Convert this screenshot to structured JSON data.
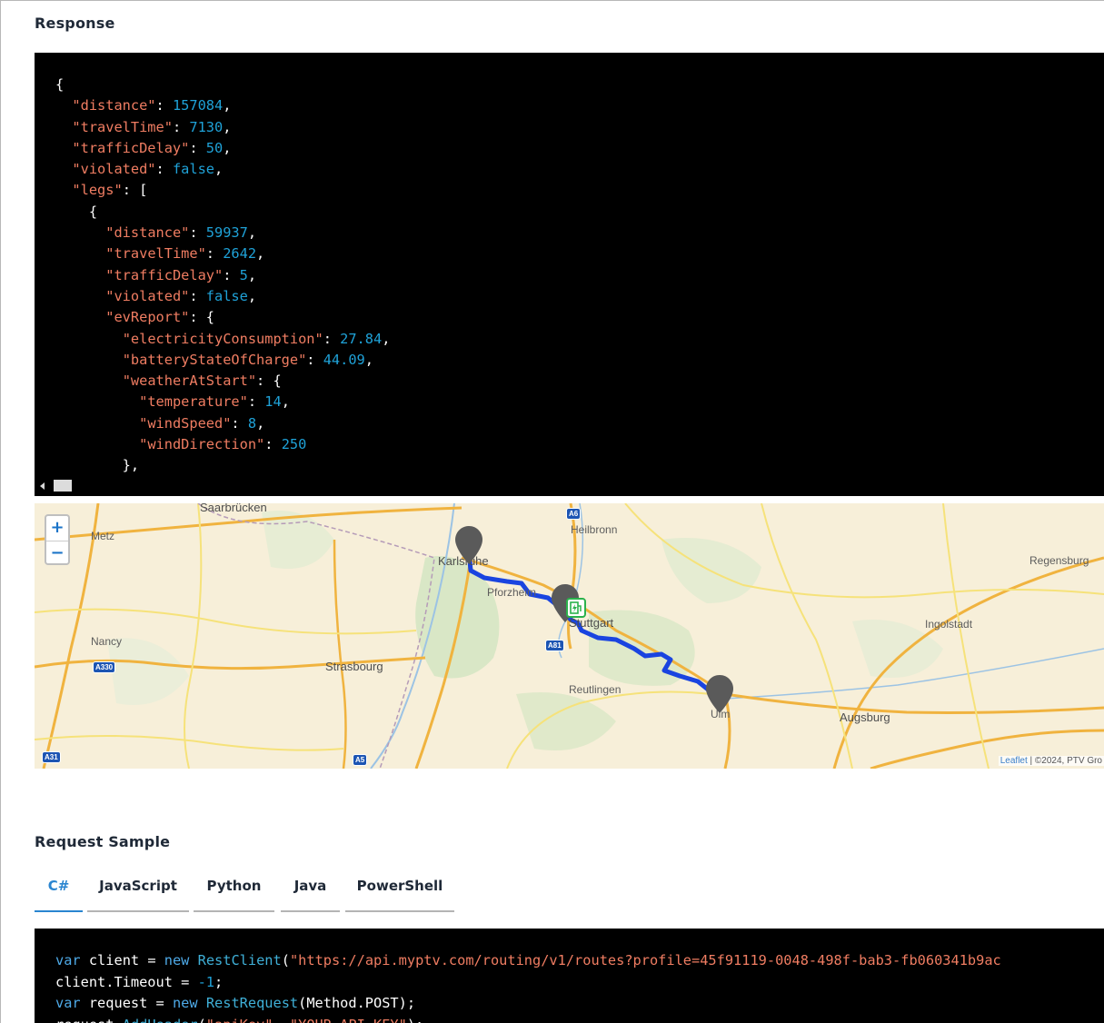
{
  "response": {
    "title": "Response",
    "json_lines": [
      [
        {
          "t": "p",
          "v": "{"
        }
      ],
      [
        {
          "t": "p",
          "v": "  "
        },
        {
          "t": "k",
          "v": "\"distance\""
        },
        {
          "t": "p",
          "v": ": "
        },
        {
          "t": "n",
          "v": "157084"
        },
        {
          "t": "p",
          "v": ","
        }
      ],
      [
        {
          "t": "p",
          "v": "  "
        },
        {
          "t": "k",
          "v": "\"travelTime\""
        },
        {
          "t": "p",
          "v": ": "
        },
        {
          "t": "n",
          "v": "7130"
        },
        {
          "t": "p",
          "v": ","
        }
      ],
      [
        {
          "t": "p",
          "v": "  "
        },
        {
          "t": "k",
          "v": "\"trafficDelay\""
        },
        {
          "t": "p",
          "v": ": "
        },
        {
          "t": "n",
          "v": "50"
        },
        {
          "t": "p",
          "v": ","
        }
      ],
      [
        {
          "t": "p",
          "v": "  "
        },
        {
          "t": "k",
          "v": "\"violated\""
        },
        {
          "t": "p",
          "v": ": "
        },
        {
          "t": "b",
          "v": "false"
        },
        {
          "t": "p",
          "v": ","
        }
      ],
      [
        {
          "t": "p",
          "v": "  "
        },
        {
          "t": "k",
          "v": "\"legs\""
        },
        {
          "t": "p",
          "v": ": ["
        }
      ],
      [
        {
          "t": "p",
          "v": "    {"
        }
      ],
      [
        {
          "t": "p",
          "v": "      "
        },
        {
          "t": "k",
          "v": "\"distance\""
        },
        {
          "t": "p",
          "v": ": "
        },
        {
          "t": "n",
          "v": "59937"
        },
        {
          "t": "p",
          "v": ","
        }
      ],
      [
        {
          "t": "p",
          "v": "      "
        },
        {
          "t": "k",
          "v": "\"travelTime\""
        },
        {
          "t": "p",
          "v": ": "
        },
        {
          "t": "n",
          "v": "2642"
        },
        {
          "t": "p",
          "v": ","
        }
      ],
      [
        {
          "t": "p",
          "v": "      "
        },
        {
          "t": "k",
          "v": "\"trafficDelay\""
        },
        {
          "t": "p",
          "v": ": "
        },
        {
          "t": "n",
          "v": "5"
        },
        {
          "t": "p",
          "v": ","
        }
      ],
      [
        {
          "t": "p",
          "v": "      "
        },
        {
          "t": "k",
          "v": "\"violated\""
        },
        {
          "t": "p",
          "v": ": "
        },
        {
          "t": "b",
          "v": "false"
        },
        {
          "t": "p",
          "v": ","
        }
      ],
      [
        {
          "t": "p",
          "v": "      "
        },
        {
          "t": "k",
          "v": "\"evReport\""
        },
        {
          "t": "p",
          "v": ": {"
        }
      ],
      [
        {
          "t": "p",
          "v": "        "
        },
        {
          "t": "k",
          "v": "\"electricityConsumption\""
        },
        {
          "t": "p",
          "v": ": "
        },
        {
          "t": "n",
          "v": "27.84"
        },
        {
          "t": "p",
          "v": ","
        }
      ],
      [
        {
          "t": "p",
          "v": "        "
        },
        {
          "t": "k",
          "v": "\"batteryStateOfCharge\""
        },
        {
          "t": "p",
          "v": ": "
        },
        {
          "t": "n",
          "v": "44.09"
        },
        {
          "t": "p",
          "v": ","
        }
      ],
      [
        {
          "t": "p",
          "v": "        "
        },
        {
          "t": "k",
          "v": "\"weatherAtStart\""
        },
        {
          "t": "p",
          "v": ": {"
        }
      ],
      [
        {
          "t": "p",
          "v": "          "
        },
        {
          "t": "k",
          "v": "\"temperature\""
        },
        {
          "t": "p",
          "v": ": "
        },
        {
          "t": "n",
          "v": "14"
        },
        {
          "t": "p",
          "v": ","
        }
      ],
      [
        {
          "t": "p",
          "v": "          "
        },
        {
          "t": "k",
          "v": "\"windSpeed\""
        },
        {
          "t": "p",
          "v": ": "
        },
        {
          "t": "n",
          "v": "8"
        },
        {
          "t": "p",
          "v": ","
        }
      ],
      [
        {
          "t": "p",
          "v": "          "
        },
        {
          "t": "k",
          "v": "\"windDirection\""
        },
        {
          "t": "p",
          "v": ": "
        },
        {
          "t": "n",
          "v": "250"
        }
      ],
      [
        {
          "t": "p",
          "v": "        },"
        }
      ]
    ]
  },
  "map": {
    "zoom_in": "+",
    "zoom_out": "−",
    "attribution_link": "Leaflet",
    "attribution_text": " | ©2024, PTV Gro",
    "cities": [
      "Saarbrücken",
      "Heilbronn",
      "Metz",
      "Karlsruhe",
      "Regensburg",
      "Pforzheim",
      "Stuttgart",
      "Ingolstadt",
      "Nancy",
      "Strasbourg",
      "Reutlingen",
      "Augsburg",
      "Ulm"
    ],
    "shields": [
      "A6",
      "A330",
      "A81",
      "A31",
      "A5"
    ],
    "route_color": "#1a44e0",
    "marker_color": "#5a5a5a"
  },
  "request": {
    "title": "Request Sample",
    "tabs": [
      "C#",
      "JavaScript",
      "Python",
      "Java",
      "PowerShell"
    ],
    "active_tab": "C#",
    "code_lines": [
      [
        {
          "t": "kw",
          "v": "var"
        },
        {
          "t": "p",
          "v": " client = "
        },
        {
          "t": "kw",
          "v": "new"
        },
        {
          "t": "p",
          "v": " "
        },
        {
          "t": "ty",
          "v": "RestClient"
        },
        {
          "t": "p",
          "v": "("
        },
        {
          "t": "st",
          "v": "\"https://api.myptv.com/routing/v1/routes?profile=45f91119-0048-498f-bab3-fb060341b9ac"
        }
      ],
      [
        {
          "t": "p",
          "v": "client.Timeout = "
        },
        {
          "t": "nm",
          "v": "-1"
        },
        {
          "t": "p",
          "v": ";"
        }
      ],
      [
        {
          "t": "kw",
          "v": "var"
        },
        {
          "t": "p",
          "v": " request = "
        },
        {
          "t": "kw",
          "v": "new"
        },
        {
          "t": "p",
          "v": " "
        },
        {
          "t": "ty",
          "v": "RestRequest"
        },
        {
          "t": "p",
          "v": "(Method.POST);"
        }
      ],
      [
        {
          "t": "p",
          "v": "request."
        },
        {
          "t": "ty",
          "v": "AddHeader"
        },
        {
          "t": "p",
          "v": "("
        },
        {
          "t": "st",
          "v": "\"apiKey\""
        },
        {
          "t": "p",
          "v": ", "
        },
        {
          "t": "st",
          "v": "\"YOUR_API_KEY\""
        },
        {
          "t": "p",
          "v": ");"
        }
      ]
    ]
  }
}
